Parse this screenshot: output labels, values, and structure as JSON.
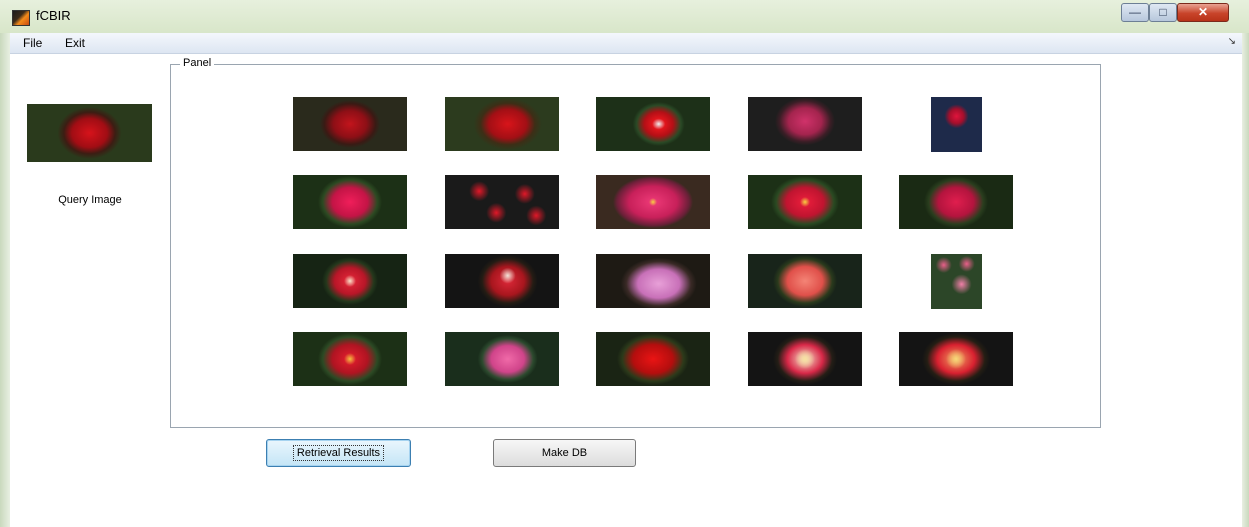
{
  "window": {
    "title": "fCBIR"
  },
  "menu": {
    "items": [
      "File",
      "Exit"
    ]
  },
  "query": {
    "label": "Query Image"
  },
  "panel": {
    "title": "Panel"
  },
  "buttons": {
    "retrieval": "Retrieval Results",
    "make_db": "Make DB"
  },
  "results": [
    [
      "red rose",
      "deep red rose",
      "red rose on leaves",
      "pink-red rose",
      "single red rose bud"
    ],
    [
      "magenta rose",
      "cluster of red roses",
      "pink roses with yellow centers",
      "red rose with yellow center",
      "magenta rose"
    ],
    [
      "red and cream rose",
      "red and white rose",
      "lavender pink rose",
      "coral rose",
      "pink rose cluster"
    ],
    [
      "red rose with yellow center",
      "pink rose",
      "red rose",
      "cream and red rose",
      "red and yellow rose"
    ]
  ],
  "colors": {
    "titlebar": "#dfe9d3",
    "menubar": "#e6edf7",
    "close_button": "#c8442a"
  }
}
